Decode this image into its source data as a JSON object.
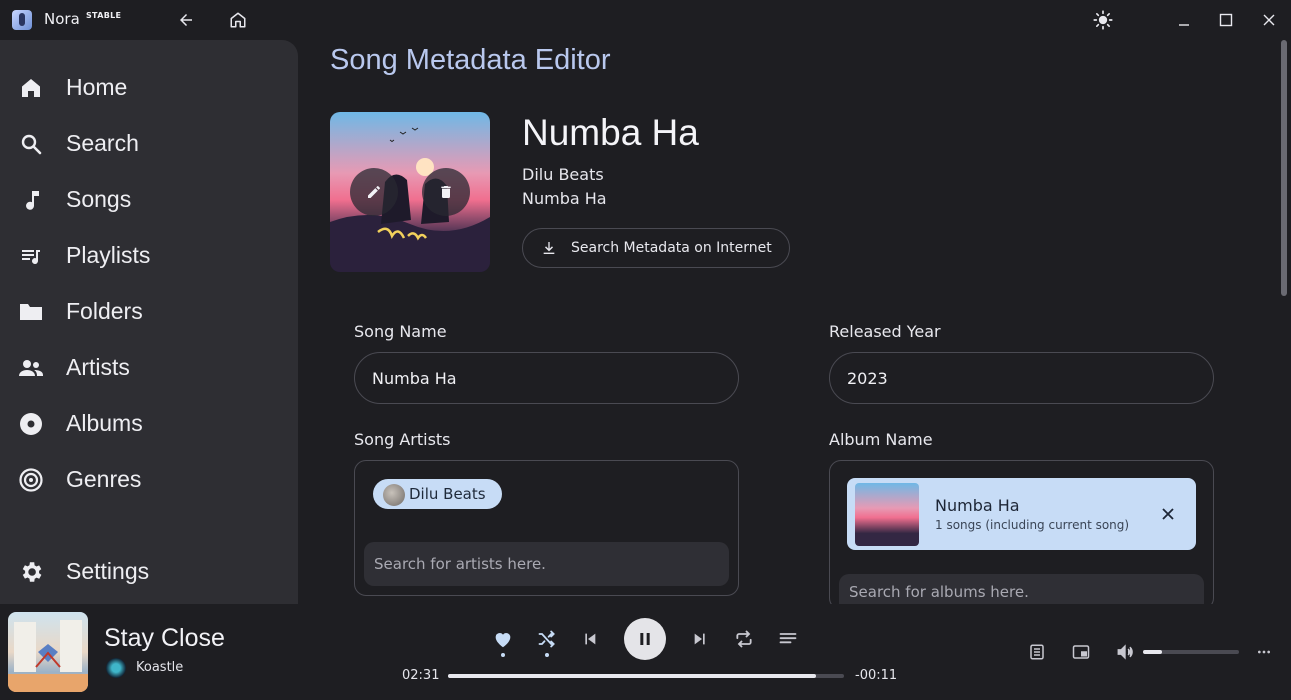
{
  "app": {
    "name": "Nora",
    "badge": "STABLE"
  },
  "sidebar": {
    "items": [
      {
        "label": "Home",
        "icon": "home-icon"
      },
      {
        "label": "Search",
        "icon": "search-icon"
      },
      {
        "label": "Songs",
        "icon": "music-note-icon"
      },
      {
        "label": "Playlists",
        "icon": "playlist-icon"
      },
      {
        "label": "Folders",
        "icon": "folder-icon"
      },
      {
        "label": "Artists",
        "icon": "people-icon"
      },
      {
        "label": "Albums",
        "icon": "album-icon"
      },
      {
        "label": "Genres",
        "icon": "genre-icon"
      }
    ],
    "settings": {
      "label": "Settings",
      "icon": "gear-icon"
    }
  },
  "main": {
    "title": "Song Metadata Editor",
    "song": {
      "title": "Numba Ha",
      "artist": "Dilu Beats",
      "album": "Numba Ha"
    },
    "search_metadata_label": "Search Metadata on Internet",
    "fields": {
      "song_name": {
        "label": "Song Name",
        "value": "Numba Ha"
      },
      "released_year": {
        "label": "Released Year",
        "value": "2023"
      },
      "song_artists": {
        "label": "Song Artists",
        "chips": [
          "Dilu Beats"
        ],
        "placeholder": "Search for artists here."
      },
      "album_name": {
        "label": "Album Name",
        "selected": {
          "name": "Numba Ha",
          "meta": "1 songs (including current song)"
        },
        "placeholder": "Search for albums here."
      }
    }
  },
  "player": {
    "title": "Stay Close",
    "artist": "Koastle",
    "elapsed": "02:31",
    "remaining": "-00:11",
    "progress": 0.93,
    "volume": 0.2,
    "liked": true
  },
  "colors": {
    "accent": "#c7dcf6",
    "title_accent": "#b9c8ee",
    "sidebar": "#2e2e33",
    "background": "#1e1e22"
  }
}
